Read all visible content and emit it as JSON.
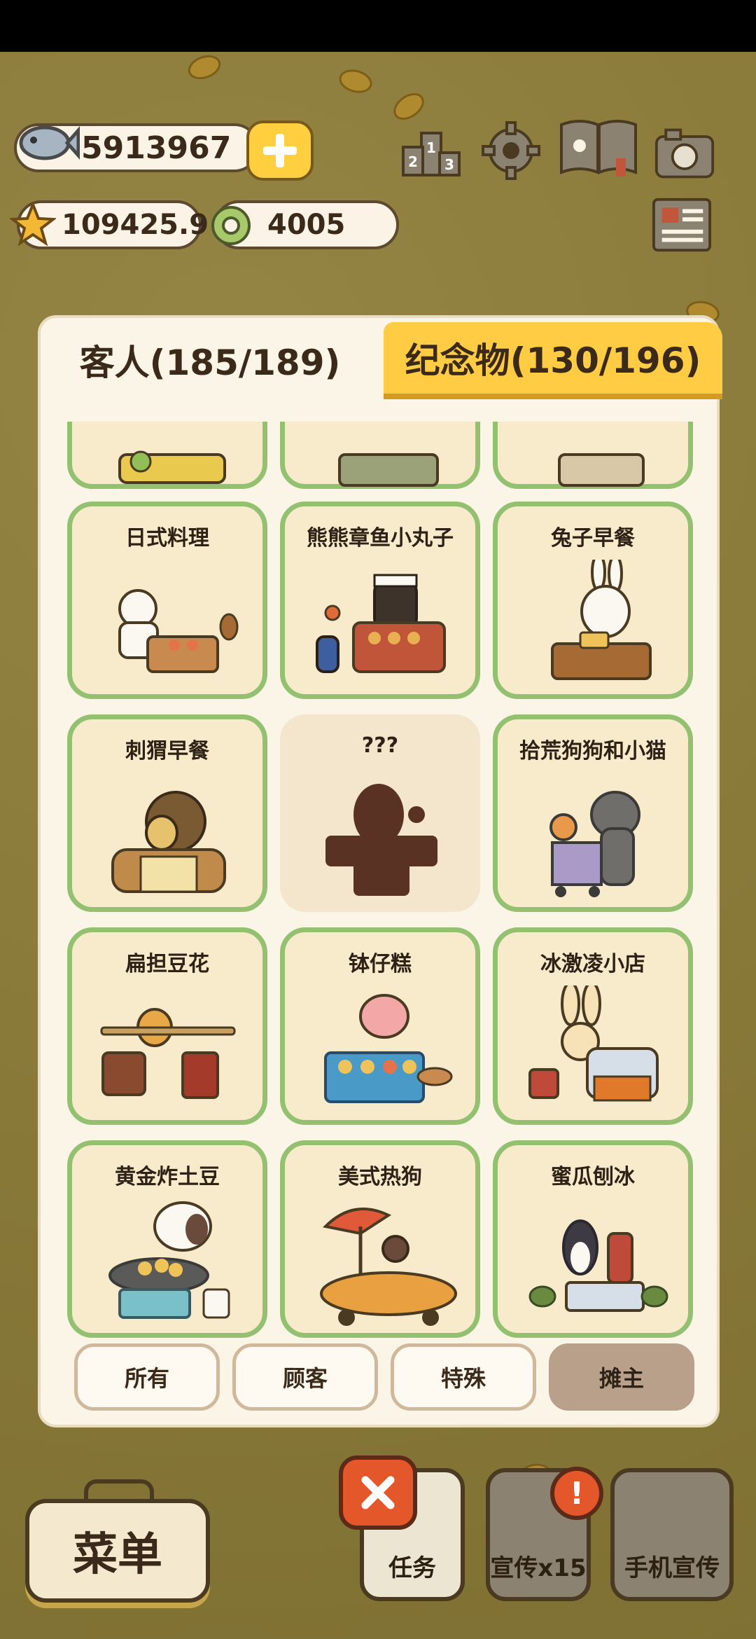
{
  "currency": {
    "fish": "5913967",
    "stars": "109425.9",
    "rings": "4005"
  },
  "tabs": {
    "guests": "客人(185/189)",
    "souvenirs": "纪念物(130/196)"
  },
  "cards": [
    {
      "title": ""
    },
    {
      "title": ""
    },
    {
      "title": ""
    },
    {
      "title": "日式料理"
    },
    {
      "title": "熊熊章鱼小丸子"
    },
    {
      "title": "兔子早餐"
    },
    {
      "title": "刺猬早餐"
    },
    {
      "title": "???"
    },
    {
      "title": "拾荒狗狗和小猫"
    },
    {
      "title": "扁担豆花"
    },
    {
      "title": "钵仔糕"
    },
    {
      "title": "冰激凌小店"
    },
    {
      "title": "黄金炸土豆"
    },
    {
      "title": "美式热狗"
    },
    {
      "title": "蜜瓜刨冰"
    }
  ],
  "filters": {
    "all": "所有",
    "customers": "顾客",
    "special": "特殊",
    "vendors": "摊主"
  },
  "bottom": {
    "menu": "菜单",
    "tasks": "任务",
    "promote": "宣传x15",
    "phone_promote": "手机宣传",
    "alert": "!"
  },
  "colors": {
    "card_border": "#93c170",
    "tab_active": "#ffcc44",
    "close_red": "#e4572a"
  }
}
